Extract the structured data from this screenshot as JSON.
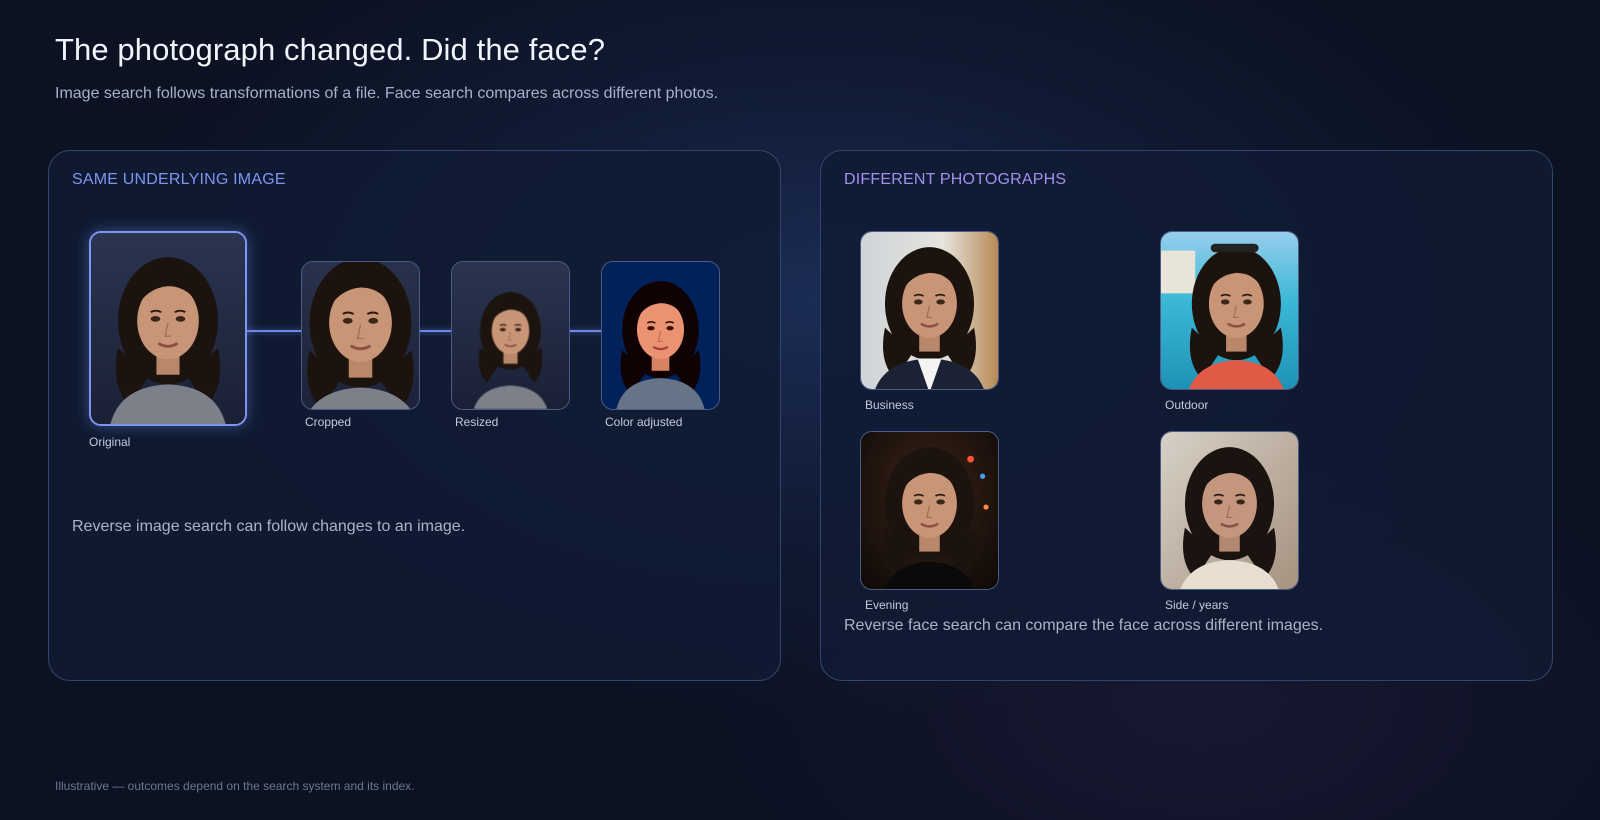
{
  "header": {
    "title": "The photograph changed. Did the face?",
    "subtitle": "Image search follows transformations of a file. Face search compares across different photos."
  },
  "left_panel": {
    "heading": "SAME UNDERLYING IMAGE",
    "original_label": "Original",
    "variants": [
      {
        "label": "Cropped"
      },
      {
        "label": "Resized"
      },
      {
        "label": "Color adjusted"
      }
    ],
    "caption": "Reverse image search can follow changes to an image."
  },
  "right_panel": {
    "heading": "DIFFERENT PHOTOGRAPHS",
    "photos": [
      {
        "label": "Business"
      },
      {
        "label": "Outdoor"
      },
      {
        "label": "Evening"
      },
      {
        "label": "Side / years"
      }
    ],
    "caption": "Reverse face search can compare the face across different images."
  },
  "footnote": "Illustrative — outcomes depend on the search system and its index.",
  "colors": {
    "accent_blue": "#7d95f1",
    "accent_violet": "#a190ee",
    "background": "#0b1222"
  }
}
